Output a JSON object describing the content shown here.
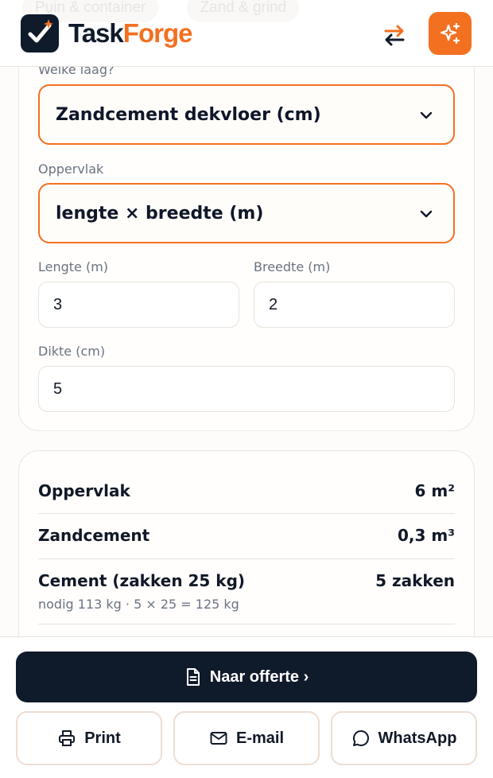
{
  "header": {
    "ghost_tabs": [
      "Puin & container",
      "Zand & grind"
    ],
    "brand_part1": "Task",
    "brand_part2": "Forge",
    "icons": {
      "logo": "checkmark-star-icon",
      "swap": "swap-arrows-icon",
      "ai": "sparkles-icon"
    },
    "accent_color": "#f37021",
    "dark_color": "#0f1a2b"
  },
  "form": {
    "layer_label": "Welke laag?",
    "layer_value": "Zandcement dekvloer (cm)",
    "area_label": "Oppervlak",
    "area_value": "lengte × breedte (m)",
    "length_label": "Lengte (m)",
    "length_value": "3",
    "width_label": "Breedte (m)",
    "width_value": "2",
    "thickness_label": "Dikte (cm)",
    "thickness_value": "5"
  },
  "results": [
    {
      "label": "Oppervlak",
      "value": "6 m²"
    },
    {
      "label": "Zandcement",
      "value": "0,3 m³"
    },
    {
      "label": "Cement (zakken 25 kg)",
      "value": "5 zakken",
      "sub": "nodig 113 kg · 5 × 25 = 125 kg"
    }
  ],
  "actions": {
    "primary": "Naar offerte ›",
    "print": "Print",
    "email": "E-mail",
    "whatsapp": "WhatsApp"
  }
}
